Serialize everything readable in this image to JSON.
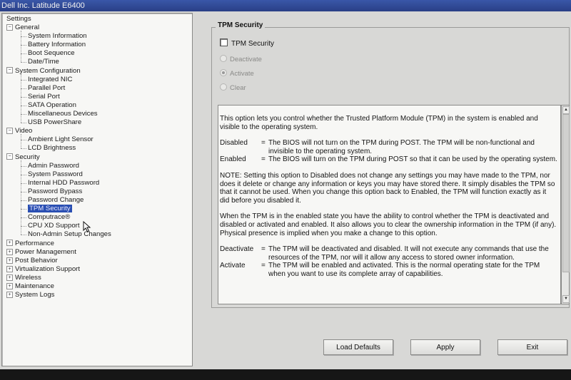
{
  "window": {
    "title": "Dell Inc. Latitude E6400"
  },
  "tree": {
    "root": "Settings",
    "categories": [
      {
        "label": "General",
        "expanded": true,
        "items": [
          "System Information",
          "Battery Information",
          "Boot Sequence",
          "Date/Time"
        ]
      },
      {
        "label": "System Configuration",
        "expanded": true,
        "items": [
          "Integrated NIC",
          "Parallel Port",
          "Serial Port",
          "SATA Operation",
          "Miscellaneous Devices",
          "USB PowerShare"
        ]
      },
      {
        "label": "Video",
        "expanded": true,
        "items": [
          "Ambient Light Sensor",
          "LCD Brightness"
        ]
      },
      {
        "label": "Security",
        "expanded": true,
        "items": [
          "Admin Password",
          "System Password",
          "Internal HDD Password",
          "Password Bypass",
          "Password Change",
          "TPM Security",
          "Computrace®",
          "CPU XD Support",
          "Non-Admin Setup Changes"
        ]
      },
      {
        "label": "Performance",
        "expanded": false,
        "items": []
      },
      {
        "label": "Power Management",
        "expanded": false,
        "items": []
      },
      {
        "label": "Post Behavior",
        "expanded": false,
        "items": []
      },
      {
        "label": "Virtualization Support",
        "expanded": false,
        "items": []
      },
      {
        "label": "Wireless",
        "expanded": false,
        "items": []
      },
      {
        "label": "Maintenance",
        "expanded": false,
        "items": []
      },
      {
        "label": "System Logs",
        "expanded": false,
        "items": []
      }
    ],
    "selected": "TPM Security"
  },
  "panel": {
    "group_title": "TPM Security",
    "checkbox_label": "TPM Security",
    "checkbox_checked": false,
    "radios": [
      {
        "label": "Deactivate",
        "selected": false
      },
      {
        "label": "Activate",
        "selected": true
      },
      {
        "label": "Clear",
        "selected": false
      }
    ]
  },
  "help": {
    "intro": "This option lets you control whether the Trusted Platform Module (TPM) in the system is enabled and visible to the operating system.",
    "defs1": [
      {
        "term": "Disabled",
        "text": "The BIOS will not turn on the TPM during POST.  The TPM will be non-functional and invisible to the operating system."
      },
      {
        "term": "Enabled",
        "text": "The BIOS will turn on the TPM during POST so that it can be used by the operating system."
      }
    ],
    "note": "NOTE: Setting this option to Disabled does not change any settings you may have made to the TPM, nor does it delete or change any information or keys you may have stored there. It simply disables the TPM so that it cannot be used. When you change this option back to Enabled, the TPM will function exactly as it did before you disabled it.",
    "state": "When the TPM is in the enabled state you have the ability to control whether the TPM is deactivated and disabled or activated and enabled.  It also allows you to clear the ownership information in the TPM (if any). Physical presence is implied when you make a change to this option.",
    "defs2": [
      {
        "term": "Deactivate",
        "text": "The TPM will be deactivated and disabled. It will not execute any commands that use the resources of the TPM, nor will it allow any access to stored owner information."
      },
      {
        "term": "Activate",
        "text": "The TPM will be enabled and activated. This is the normal operating state for the TPM when you want to use its complete array of capabilities."
      }
    ]
  },
  "buttons": {
    "load_defaults": "Load Defaults",
    "apply": "Apply",
    "exit": "Exit"
  }
}
